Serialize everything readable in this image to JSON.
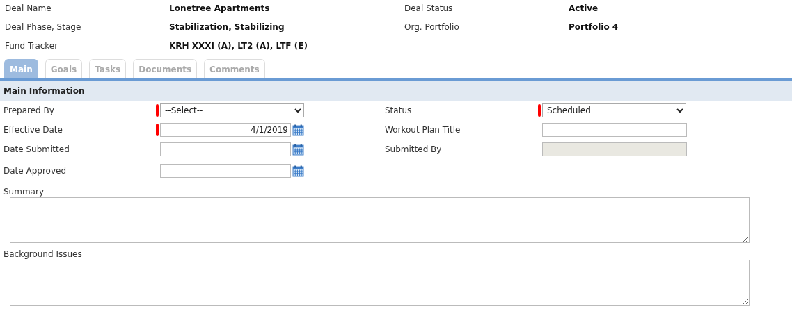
{
  "deal_info": [
    {
      "label": "Deal Name",
      "value": "Lonetree Apartments"
    },
    {
      "label": "Deal Status",
      "value": "Active"
    },
    {
      "label": "Deal Phase, Stage",
      "value": "Stabilization, Stabilizing"
    },
    {
      "label": "Org. Portfolio",
      "value": "Portfolio 4"
    },
    {
      "label": "Fund Tracker",
      "value": "KRH XXXI (A), LT2 (A), LTF (E)"
    }
  ],
  "tabs": [
    {
      "label": "Main",
      "selected": true
    },
    {
      "label": "Goals",
      "selected": false
    },
    {
      "label": "Tasks",
      "selected": false
    },
    {
      "label": "Documents",
      "selected": false
    },
    {
      "label": "Comments",
      "selected": false
    }
  ],
  "section_title": "Main Information",
  "form_rows": [
    [
      {
        "label": "Prepared By",
        "kind": "select",
        "required": true,
        "value": "--Select--"
      },
      {
        "label": "Status",
        "kind": "select",
        "required": true,
        "value": "Scheduled"
      }
    ],
    [
      {
        "label": "Effective Date",
        "kind": "date",
        "required": true,
        "value": "4/1/2019"
      },
      {
        "label": "Workout Plan Title",
        "kind": "text",
        "required": false
      }
    ],
    [
      {
        "label": "Date Submitted",
        "kind": "date",
        "required": false
      },
      {
        "label": "Submitted By",
        "kind": "text",
        "required": false,
        "disabled": true
      }
    ],
    [
      {
        "label": "Date Approved",
        "kind": "date",
        "required": false
      }
    ]
  ],
  "text_areas": [
    {
      "label": "Summary"
    },
    {
      "label": "Background Issues"
    }
  ]
}
